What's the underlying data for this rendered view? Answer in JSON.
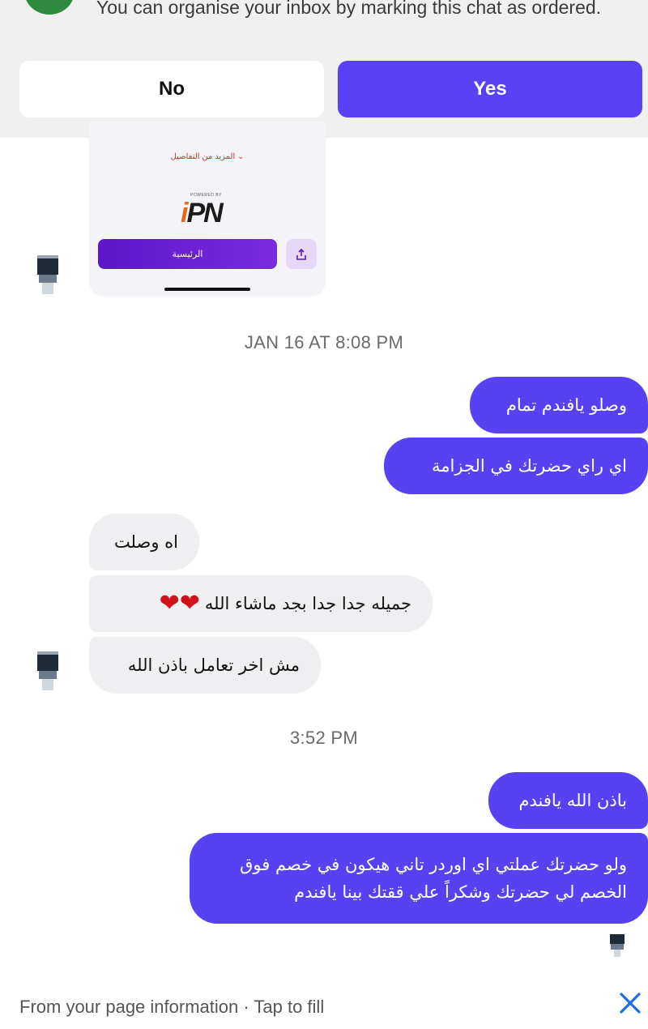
{
  "banner": {
    "message": "You can organise your inbox by marking this chat as ordered.",
    "no_label": "No",
    "yes_label": "Yes"
  },
  "shared_preview": {
    "more_details": "المزيد من التفاصيل ⌄",
    "powered_by": "POWERED BY",
    "logo_text": "iPN",
    "home_label": "الرئيسية",
    "share_icon": "share-icon"
  },
  "timestamps": {
    "first": "JAN 16 AT 8:08 PM",
    "second": "3:52 PM"
  },
  "messages": [
    {
      "direction": "out",
      "text": "وصلو يافندم تمام"
    },
    {
      "direction": "out",
      "text": "اي راي حضرتك في الجزامة"
    },
    {
      "direction": "in",
      "text": "اه وصلت"
    },
    {
      "direction": "in",
      "text": "جميله جدا جدا بجد ماشاء الله",
      "emoji": "❤❤"
    },
    {
      "direction": "in",
      "text": "مش اخر تعامل باذن الله"
    },
    {
      "direction": "out",
      "text": "باذن الله يافندم"
    },
    {
      "direction": "out",
      "text": "ولو حضرتك عملتي اي اوردر تاني هيكون في خصم فوق الخصم لي حضرتك وشكراً علي ققتك بينا يافندم"
    }
  ],
  "bottom_bar": {
    "hint": "From your page information · Tap to fill",
    "close_icon": "close-icon"
  },
  "colors": {
    "accent": "#5841f2",
    "incoming_bubble": "#efeff1",
    "banner_bg": "#f0f0f0",
    "close_icon": "#1b6fe0"
  }
}
